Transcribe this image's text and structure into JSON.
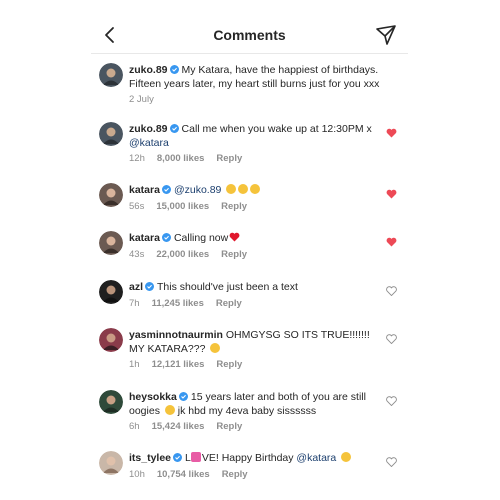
{
  "header": {
    "title": "Comments",
    "back_icon": "back-chevron-icon",
    "send_icon": "send-icon"
  },
  "colors": {
    "liked_heart": "#ed4956",
    "verified": "#3897f0",
    "mention": "#1c3f6e"
  },
  "comments": [
    {
      "username": "zuko.89",
      "verified": true,
      "text": "My Katara, have the happiest of birthdays. Fifteen years later, my heart still burns just for you xxx",
      "time": "2 July",
      "likes": "",
      "reply": "",
      "liked": null,
      "avatar_color": "#4a5560"
    },
    {
      "username": "zuko.89",
      "verified": true,
      "text": "Call me when you wake up at 12:30PM x ",
      "mention": "@katara",
      "time": "12h",
      "likes": "8,000 likes",
      "reply": "Reply",
      "liked": true,
      "avatar_color": "#4a5560"
    },
    {
      "username": "katara",
      "verified": true,
      "mention_first": "@zuko.89",
      "text": "",
      "emoji": [
        "grimace",
        "grimace",
        "grimace"
      ],
      "time": "56s",
      "likes": "15,000 likes",
      "reply": "Reply",
      "liked": true,
      "avatar_color": "#6b5a52"
    },
    {
      "username": "katara",
      "verified": true,
      "text": "Calling now",
      "emoji": [
        "red-heart"
      ],
      "time": "43s",
      "likes": "22,000 likes",
      "reply": "Reply",
      "liked": true,
      "avatar_color": "#6b5a52"
    },
    {
      "username": "azl",
      "verified": true,
      "text": "This should've just been a text",
      "time": "7h",
      "likes": "11,245 likes",
      "reply": "Reply",
      "liked": false,
      "avatar_color": "#1f1f1f"
    },
    {
      "username": "yasminnotnaurmin",
      "verified": false,
      "text": "OHMGYSG SO ITS TRUE!!!!!!! MY KATARA???",
      "emoji": [
        "pleading"
      ],
      "time": "1h",
      "likes": "12,121 likes",
      "reply": "Reply",
      "liked": false,
      "avatar_color": "#8a3b4a"
    },
    {
      "username": "heysokka",
      "verified": true,
      "text": "15 years later and both of you are still oogies",
      "emoji_mid": [
        "zany"
      ],
      "text_after": " jk hbd my 4eva baby sissssss",
      "time": "6h",
      "likes": "15,424 likes",
      "reply": "Reply",
      "liked": false,
      "avatar_color": "#2f4a3a"
    },
    {
      "username": "its_tylee",
      "verified": true,
      "text_pre": "L",
      "emoji_inline": [
        "pink-heart"
      ],
      "text": "VE! Happy Birthday ",
      "mention": "@katara",
      "emoji": [
        "smiling-hearts"
      ],
      "time": "10h",
      "likes": "10,754 likes",
      "reply": "Reply",
      "liked": false,
      "avatar_color": "#c9b7a8"
    }
  ]
}
